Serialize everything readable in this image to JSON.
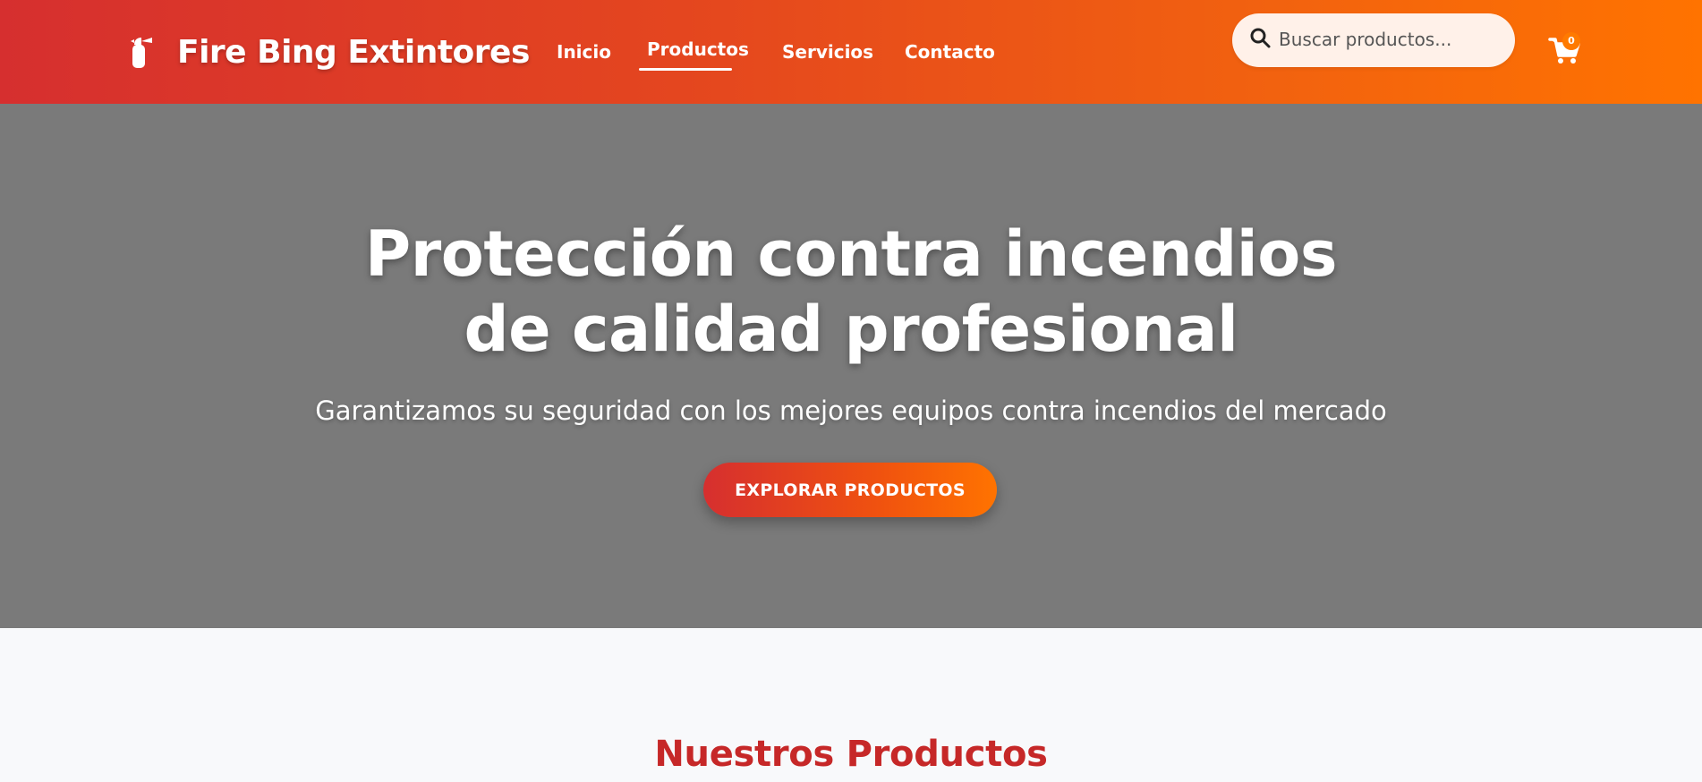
{
  "brand": {
    "icon": "fire-extinguisher-icon",
    "title": "Fire Bing Extintores"
  },
  "nav": {
    "items": [
      {
        "label": "Inicio",
        "active": false
      },
      {
        "label": "Productos",
        "active": true
      },
      {
        "label": "Servicios",
        "active": false
      },
      {
        "label": "Contacto",
        "active": false
      }
    ]
  },
  "search": {
    "icon": "search-icon",
    "placeholder": "Buscar productos...",
    "value": ""
  },
  "cart": {
    "icon": "shopping-cart-icon",
    "count": "0"
  },
  "hero": {
    "title_line1": "Protección contra incendios",
    "title_line2": "de calidad profesional",
    "subtitle": "Garantizamos su seguridad con los mejores equipos contra incendios del mercado",
    "button_label": "EXPLORAR PRODUCTOS"
  },
  "products_section": {
    "title": "Nuestros Productos"
  },
  "colors": {
    "header_gradient_start": "#d62f2f",
    "header_gradient_end": "#ff7300",
    "hero_background": "#7a7a7a",
    "section_title": "#c62828",
    "search_background": "#fff1e9"
  }
}
